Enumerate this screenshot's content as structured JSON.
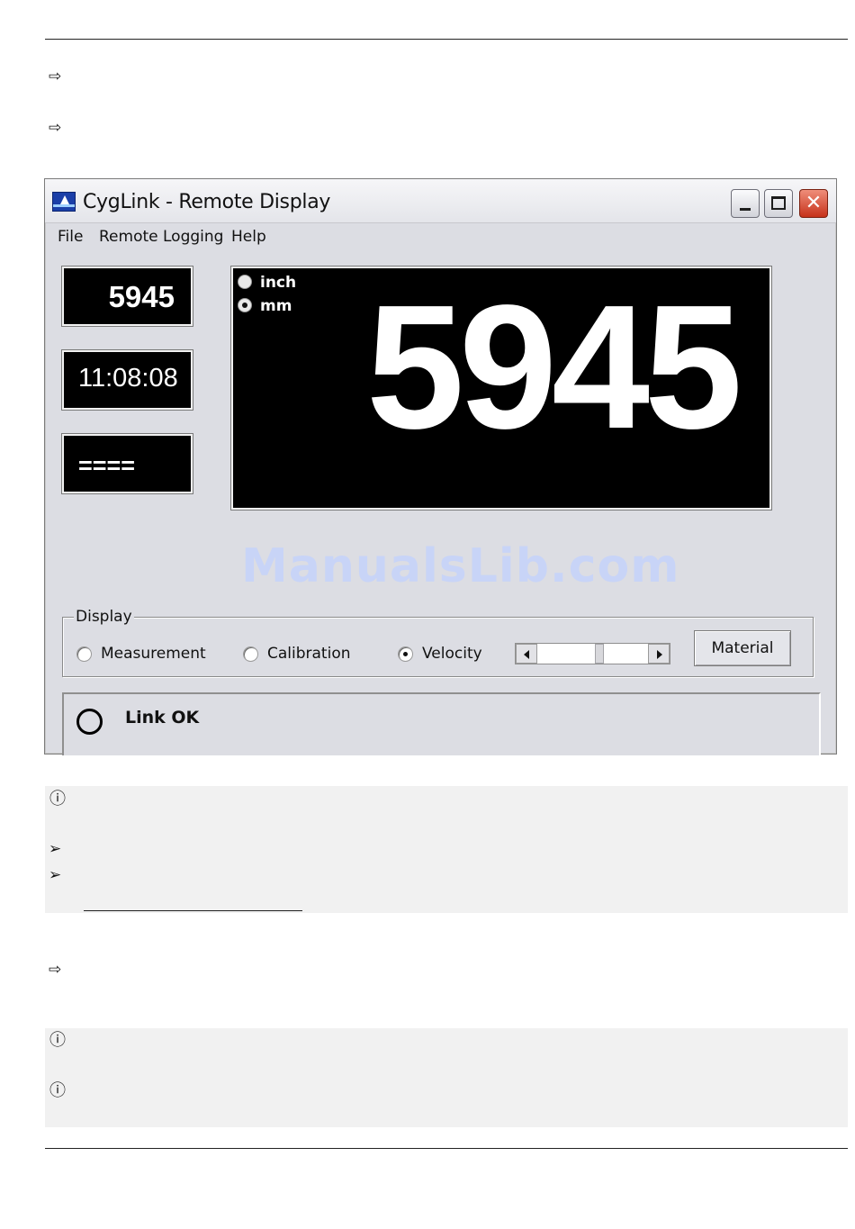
{
  "page": {
    "arrow_glyph": "⇨",
    "info_glyph": "ⓘ",
    "bullet_glyph": "➢"
  },
  "window": {
    "title": "CygLink - Remote Display",
    "close_glyph": "✕",
    "menu": [
      "File",
      "Remote Logging",
      "Help"
    ],
    "small_displays": {
      "measurement": "5945",
      "clock": "11:08:08",
      "status": "===="
    },
    "main_display": {
      "value": "5945",
      "units": [
        {
          "label": "inch",
          "selected": false
        },
        {
          "label": "mm",
          "selected": true
        }
      ]
    },
    "watermark": "ManualsLib.com",
    "display_group": {
      "legend": "Display",
      "options": [
        {
          "label": "Measurement",
          "selected": false
        },
        {
          "label": "Calibration",
          "selected": false
        },
        {
          "label": "Velocity",
          "selected": true
        }
      ],
      "material_button": "Material"
    },
    "statusbar": {
      "link_text": "Link OK"
    }
  }
}
